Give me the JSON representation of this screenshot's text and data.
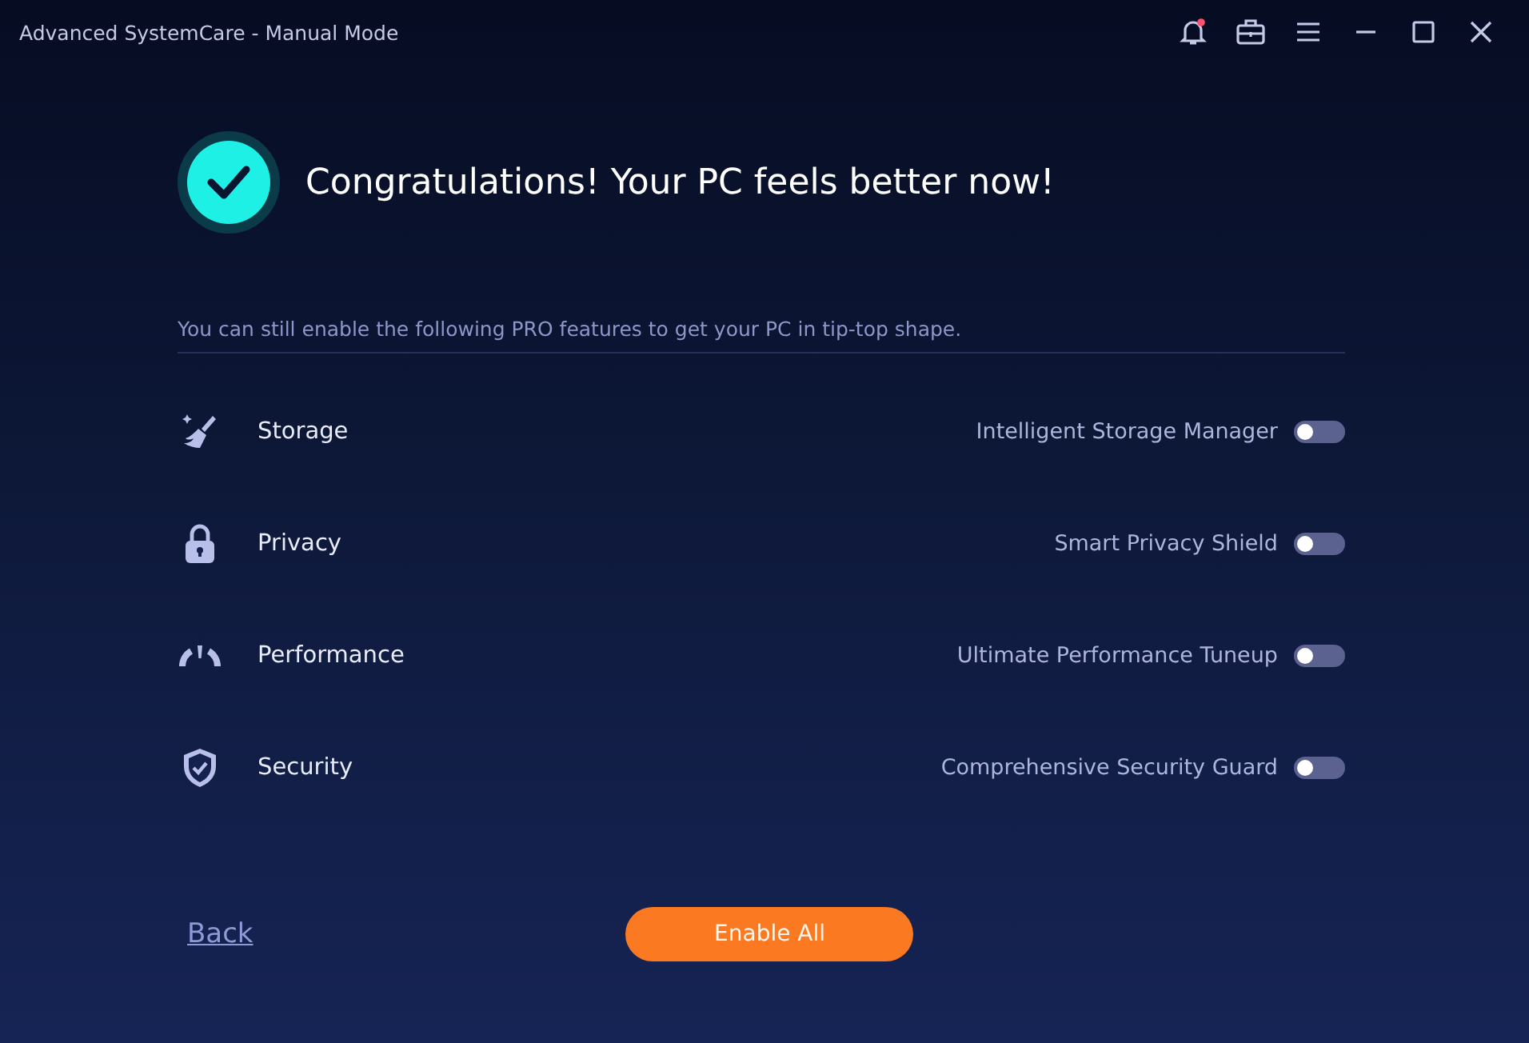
{
  "window": {
    "title": "Advanced SystemCare - Manual Mode"
  },
  "header": {
    "title": "Congratulations! Your PC feels better now!"
  },
  "subtitle": "You can still enable the following PRO features to get your PC in tip-top shape.",
  "features": [
    {
      "kind": "storage",
      "category": "Storage",
      "feature": "Intelligent Storage Manager",
      "on": false
    },
    {
      "kind": "privacy",
      "category": "Privacy",
      "feature": "Smart Privacy Shield",
      "on": false
    },
    {
      "kind": "performance",
      "category": "Performance",
      "feature": "Ultimate Performance Tuneup",
      "on": false
    },
    {
      "kind": "security",
      "category": "Security",
      "feature": "Comprehensive Security Guard",
      "on": false
    }
  ],
  "footer": {
    "back": "Back",
    "enable_all": "Enable All"
  }
}
